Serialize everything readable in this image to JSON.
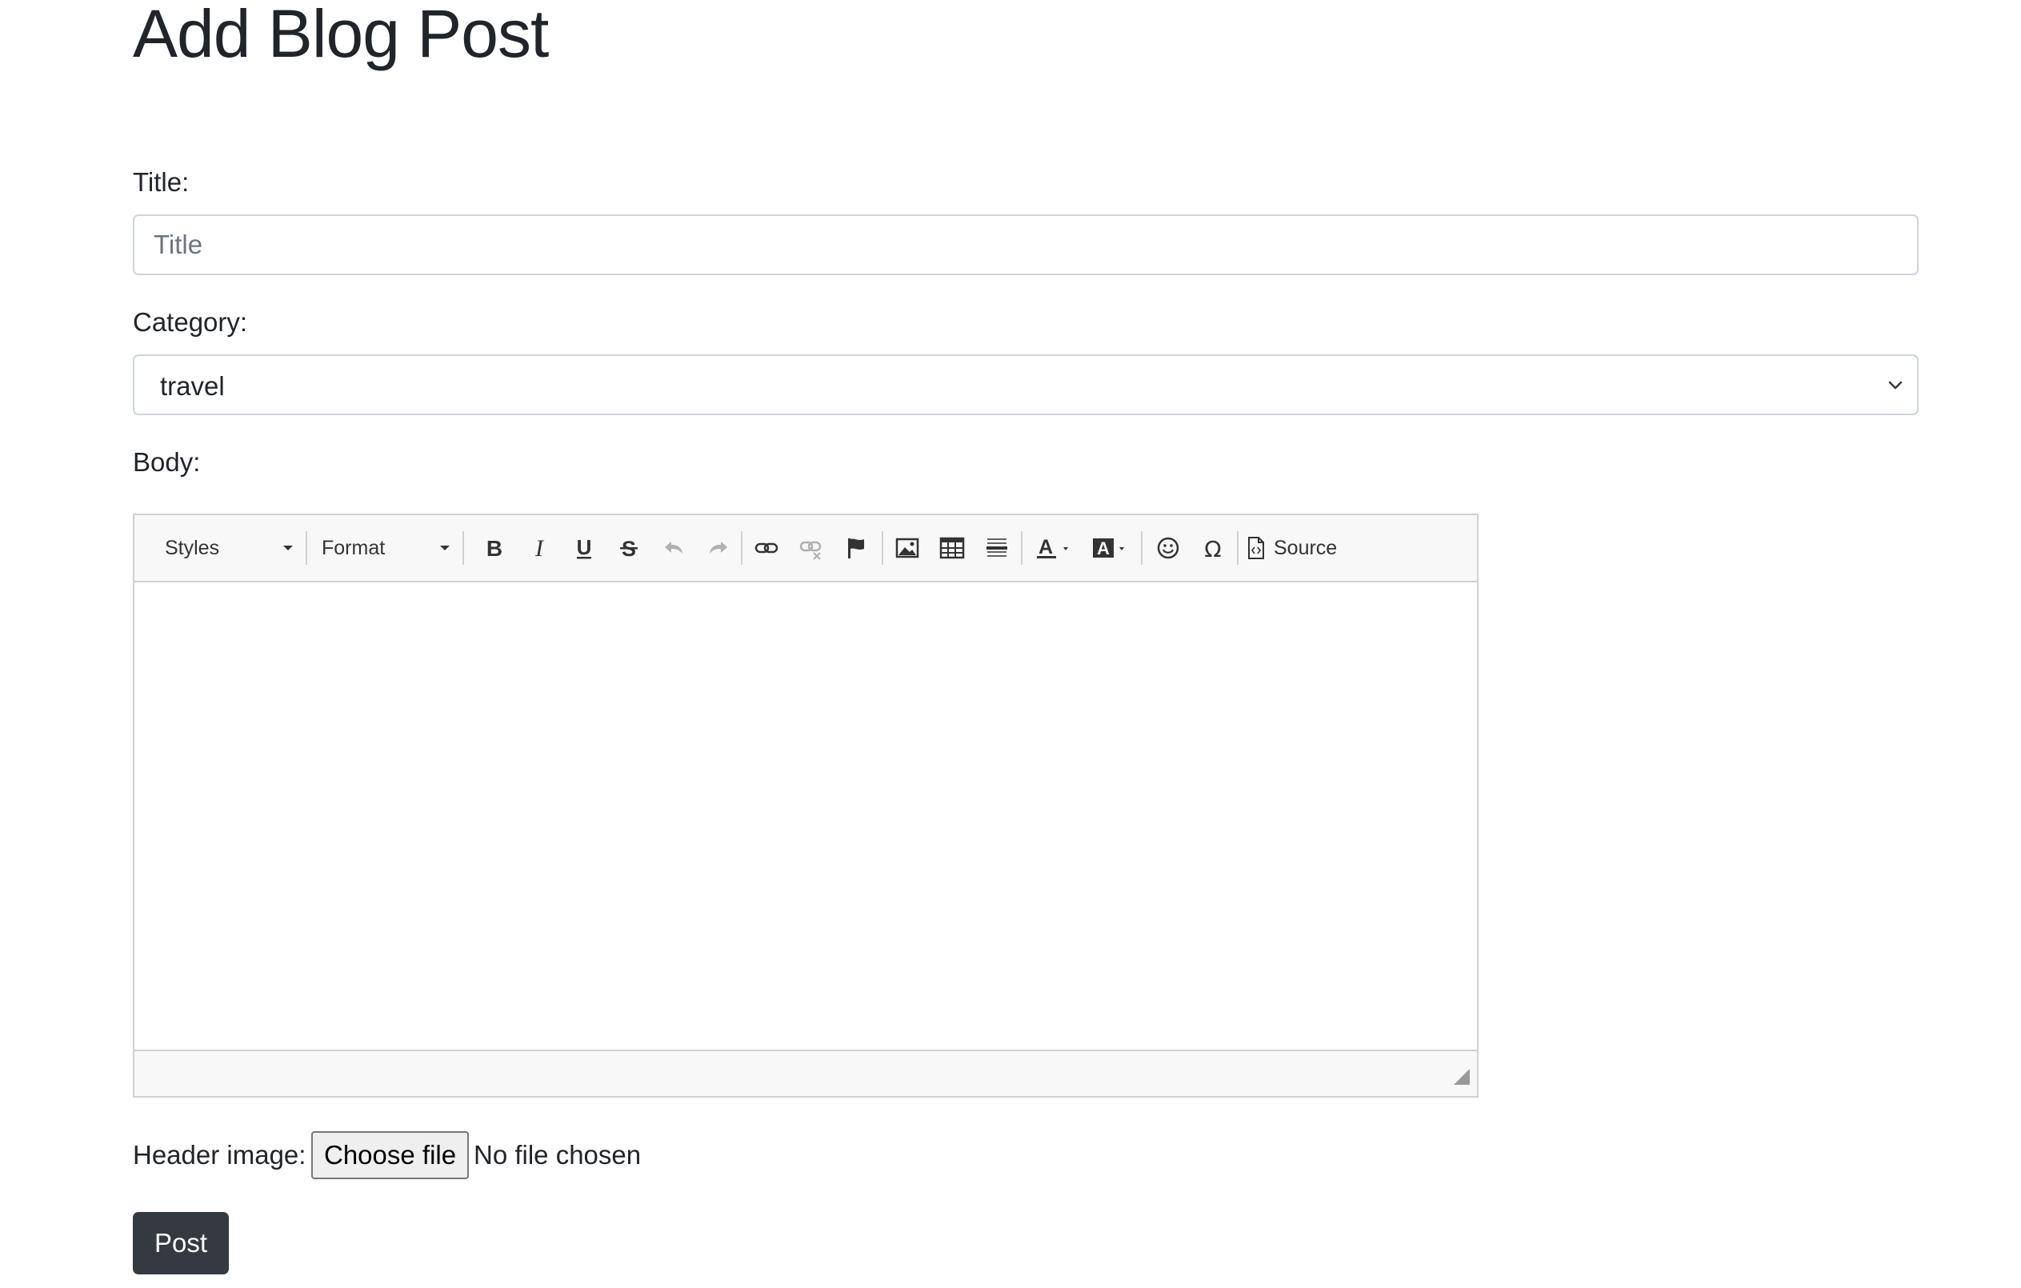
{
  "page": {
    "title": "Add Blog Post"
  },
  "form": {
    "title_label": "Title:",
    "title_value": "",
    "title_placeholder": "Title",
    "category_label": "Category:",
    "category_selected": "travel",
    "body_label": "Body:",
    "header_image_label": "Header image:",
    "choose_file_label": "Choose file",
    "file_status": "No file chosen",
    "submit_label": "Post"
  },
  "editor": {
    "toolbar": {
      "styles_label": "Styles",
      "format_label": "Format",
      "source_label": "Source",
      "buttons": [
        "bold-icon",
        "italic-icon",
        "underline-icon",
        "strikethrough-icon",
        "undo-icon",
        "redo-icon",
        "link-icon",
        "unlink-icon",
        "anchor-flag-icon",
        "image-icon",
        "table-icon",
        "horizontal-line-icon",
        "text-color-icon",
        "background-color-icon",
        "smiley-icon",
        "special-character-icon",
        "source-icon"
      ]
    },
    "body_content": ""
  },
  "colors": {
    "text": "#212529",
    "input_border": "#ced4da",
    "placeholder": "#6c757d",
    "editor_border": "#d1d1d1",
    "editor_toolbar_bg": "#f8f8f8",
    "post_button_bg": "#343a40",
    "post_button_text": "#ffffff"
  }
}
